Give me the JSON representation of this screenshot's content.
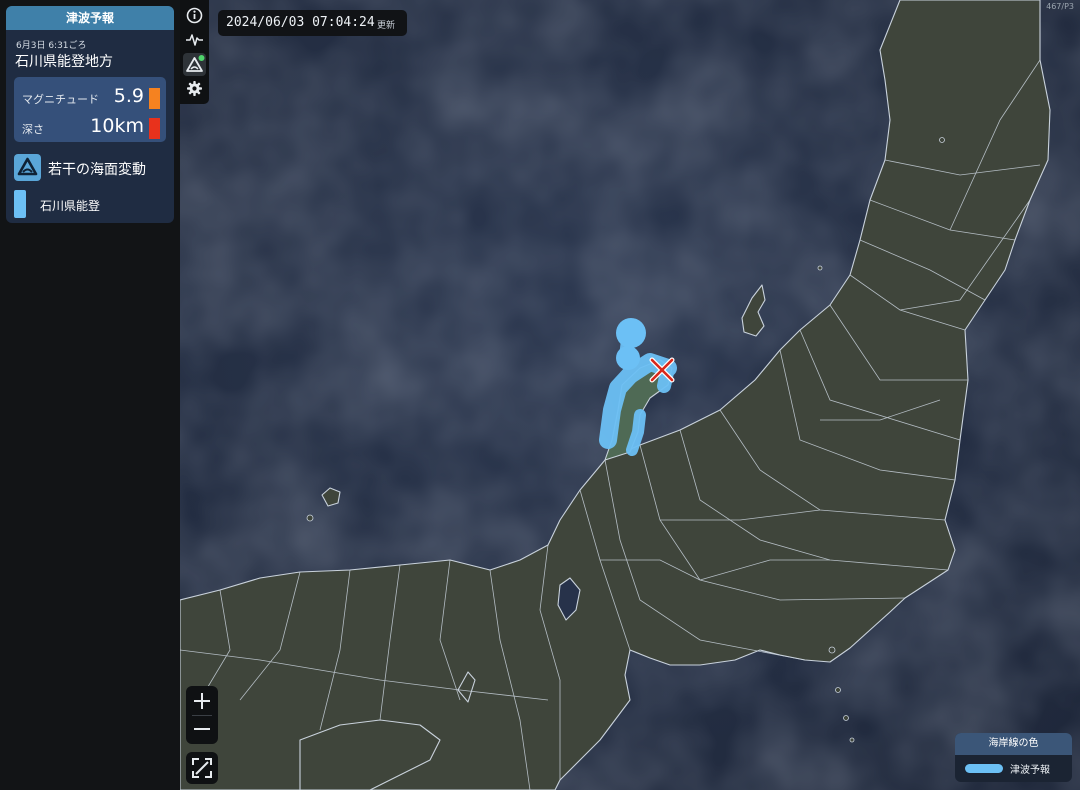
{
  "panel": {
    "header": "津波予報",
    "time": "6月3日 6:31ごろ",
    "region": "石川県能登地方",
    "magnitude": {
      "label": "マグニチュード",
      "value": "5.9",
      "color": "#f58220"
    },
    "depth": {
      "label": "深さ",
      "value": "10km",
      "color": "#e8321c"
    },
    "tsunami": {
      "title": "若干の海面変動",
      "icon": "tsunami-warning-icon"
    },
    "area": {
      "name": "石川県能登",
      "color": "#6cc0f5"
    }
  },
  "toolbar": {
    "items": [
      {
        "icon": "info-icon"
      },
      {
        "icon": "waveform-icon"
      },
      {
        "icon": "tsunami-layer-icon",
        "active": true
      },
      {
        "icon": "gear-icon"
      }
    ]
  },
  "timestamp": {
    "datetime": "2024/06/03 07:04:24",
    "suffix": "更新"
  },
  "version": "467/P3",
  "map": {
    "land_color": "#3f453b",
    "sea_color": "#27324a",
    "border_color": "#c9d2dc",
    "tsunami_coast_color": "#6cc0f5",
    "epicenter_icon": "epicenter-x-icon"
  },
  "zoom": {
    "in_icon": "plus-icon",
    "out_icon": "minus-icon",
    "fullscreen_icon": "fullscreen-icon"
  },
  "legend": {
    "title": "海岸線の色",
    "label": "津波予報",
    "color": "#6cc0f5"
  }
}
